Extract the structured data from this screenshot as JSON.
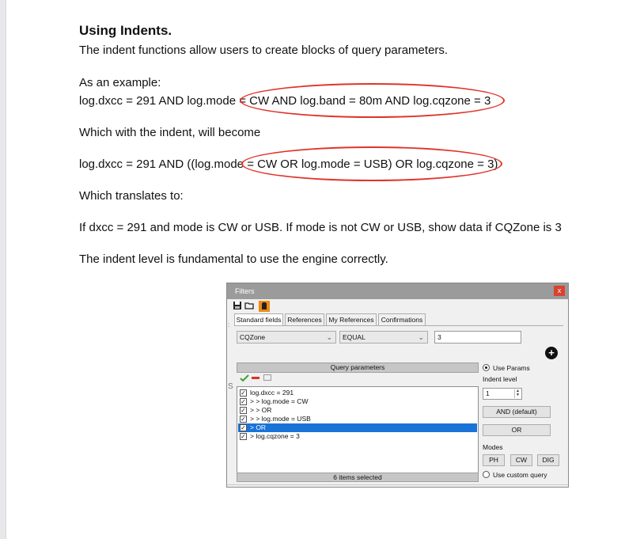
{
  "document": {
    "heading": "Using Indents.",
    "intro": "The indent functions allow users to create blocks of query parameters.",
    "example_label": "As an example:",
    "example_query": "log.dxcc = 291 AND log.mode = CW AND log.band = 80m AND log.cqzone = 3",
    "indent_label": "Which with the indent, will become",
    "indented_query": "log.dxcc = 291 AND ((log.mode = CW OR log.mode = USB) OR log.cqzone = 3)",
    "translates_label": "Which translates to:",
    "translation": "If dxcc = 291 and  mode is CW or USB. If mode is not CW or USB, show data if CQZone is 3",
    "closing": "The indent level is fundamental to use the engine correctly.",
    "highlight_color": "#e0342a"
  },
  "filters_window": {
    "title": "Filters",
    "close_label": "x",
    "toolbar": [
      {
        "icon": "save-icon"
      },
      {
        "icon": "open-folder-icon"
      },
      {
        "icon": "clipboard-icon"
      }
    ],
    "tabs": [
      {
        "label": "Standard fields",
        "active": true
      },
      {
        "label": "References",
        "active": false
      },
      {
        "label": "My References",
        "active": false
      },
      {
        "label": "Confirmations",
        "active": false
      }
    ],
    "field_select": "CQZone",
    "operator_select": "EQUAL",
    "value_input": "3",
    "add_icon": "plus-circle-icon",
    "query_header": "Query parameters",
    "query_rows": [
      {
        "text": "log.dxcc = 291",
        "checked": true,
        "selected": false
      },
      {
        "text": "> > log.mode = CW",
        "checked": true,
        "selected": false
      },
      {
        "text": "> > OR",
        "checked": true,
        "selected": false
      },
      {
        "text": "> > log.mode = USB",
        "checked": true,
        "selected": false
      },
      {
        "text": "> OR",
        "checked": true,
        "selected": true
      },
      {
        "text": "> log.cqzone = 3",
        "checked": true,
        "selected": false
      }
    ],
    "status": "6 items selected",
    "use_params_label": "Use Params",
    "indent_level_label": "Indent level",
    "indent_level_value": "1",
    "and_button": "AND (default)",
    "or_button": "OR",
    "modes_label": "Modes",
    "mode_buttons": [
      "PH",
      "CW",
      "DIG"
    ],
    "custom_query_label": "Use custom query",
    "accent_color": "#1a73d8"
  }
}
